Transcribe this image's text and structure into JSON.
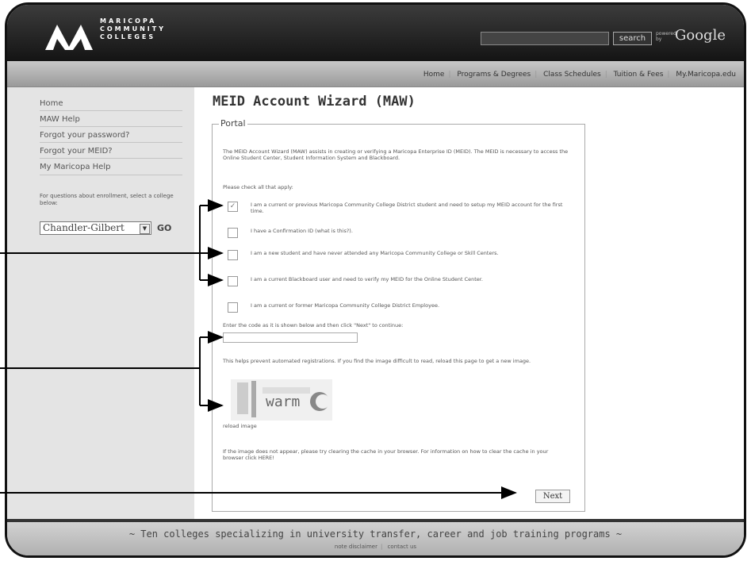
{
  "header": {
    "logo_text": [
      "MARICOPA",
      "COMMUNITY",
      "COLLEGES"
    ],
    "search_button": "search",
    "powered_by": "powered by",
    "google": "Google"
  },
  "nav": {
    "items": [
      "Home",
      "Programs & Degrees",
      "Class Schedules",
      "Tuition & Fees",
      "My.Maricopa.edu"
    ]
  },
  "sidebar": {
    "items": [
      "Home",
      "MAW Help",
      "Forgot your password?",
      "Forgot your MEID?",
      "My Maricopa Help"
    ],
    "help_text": "For questions about enrollment, select a college below:",
    "college_selected": "Chandler-Gilbert",
    "go_label": "GO"
  },
  "main": {
    "title": "MEID Account Wizard (MAW)",
    "legend": "Portal",
    "intro": "The MEID Account Wizard (MAW) assists in creating or verifying a Maricopa Enterprise ID (MEID). The MEID is necessary to access the Online Student Center, Student Information System and Blackboard.",
    "check_label": "Please check all that apply:",
    "options": [
      {
        "text": "I am a current or previous Maricopa Community College District student and need to setup my MEID account for the first time.",
        "checked": true
      },
      {
        "text": "I have a Confirmation ID (what is this?).",
        "checked": false
      },
      {
        "text": "I am a new student and have never attended any Maricopa Community College or Skill Centers.",
        "checked": false
      },
      {
        "text": "I am a current Blackboard user and need to verify my MEID for the Online Student Center.",
        "checked": false
      },
      {
        "text": "I am a current or former Maricopa Community College District Employee.",
        "checked": false
      }
    ],
    "captcha_label": "Enter the code as it is shown below and then click \"Next\" to continue:",
    "captcha_help": "This helps prevent automated registrations. If you find the image difficult to read, reload this page to get a new image.",
    "captcha_word": "warm",
    "reload_label": "reload image",
    "cache_note": "If the image does not appear, please try clearing the cache in your browser. For information on how to clear the cache in your browser click HERE!",
    "next_label": "Next"
  },
  "footer": {
    "tagline": "~ Ten colleges specializing in university transfer, career and job training programs ~",
    "links": [
      "note disclaimer",
      "contact us"
    ]
  }
}
